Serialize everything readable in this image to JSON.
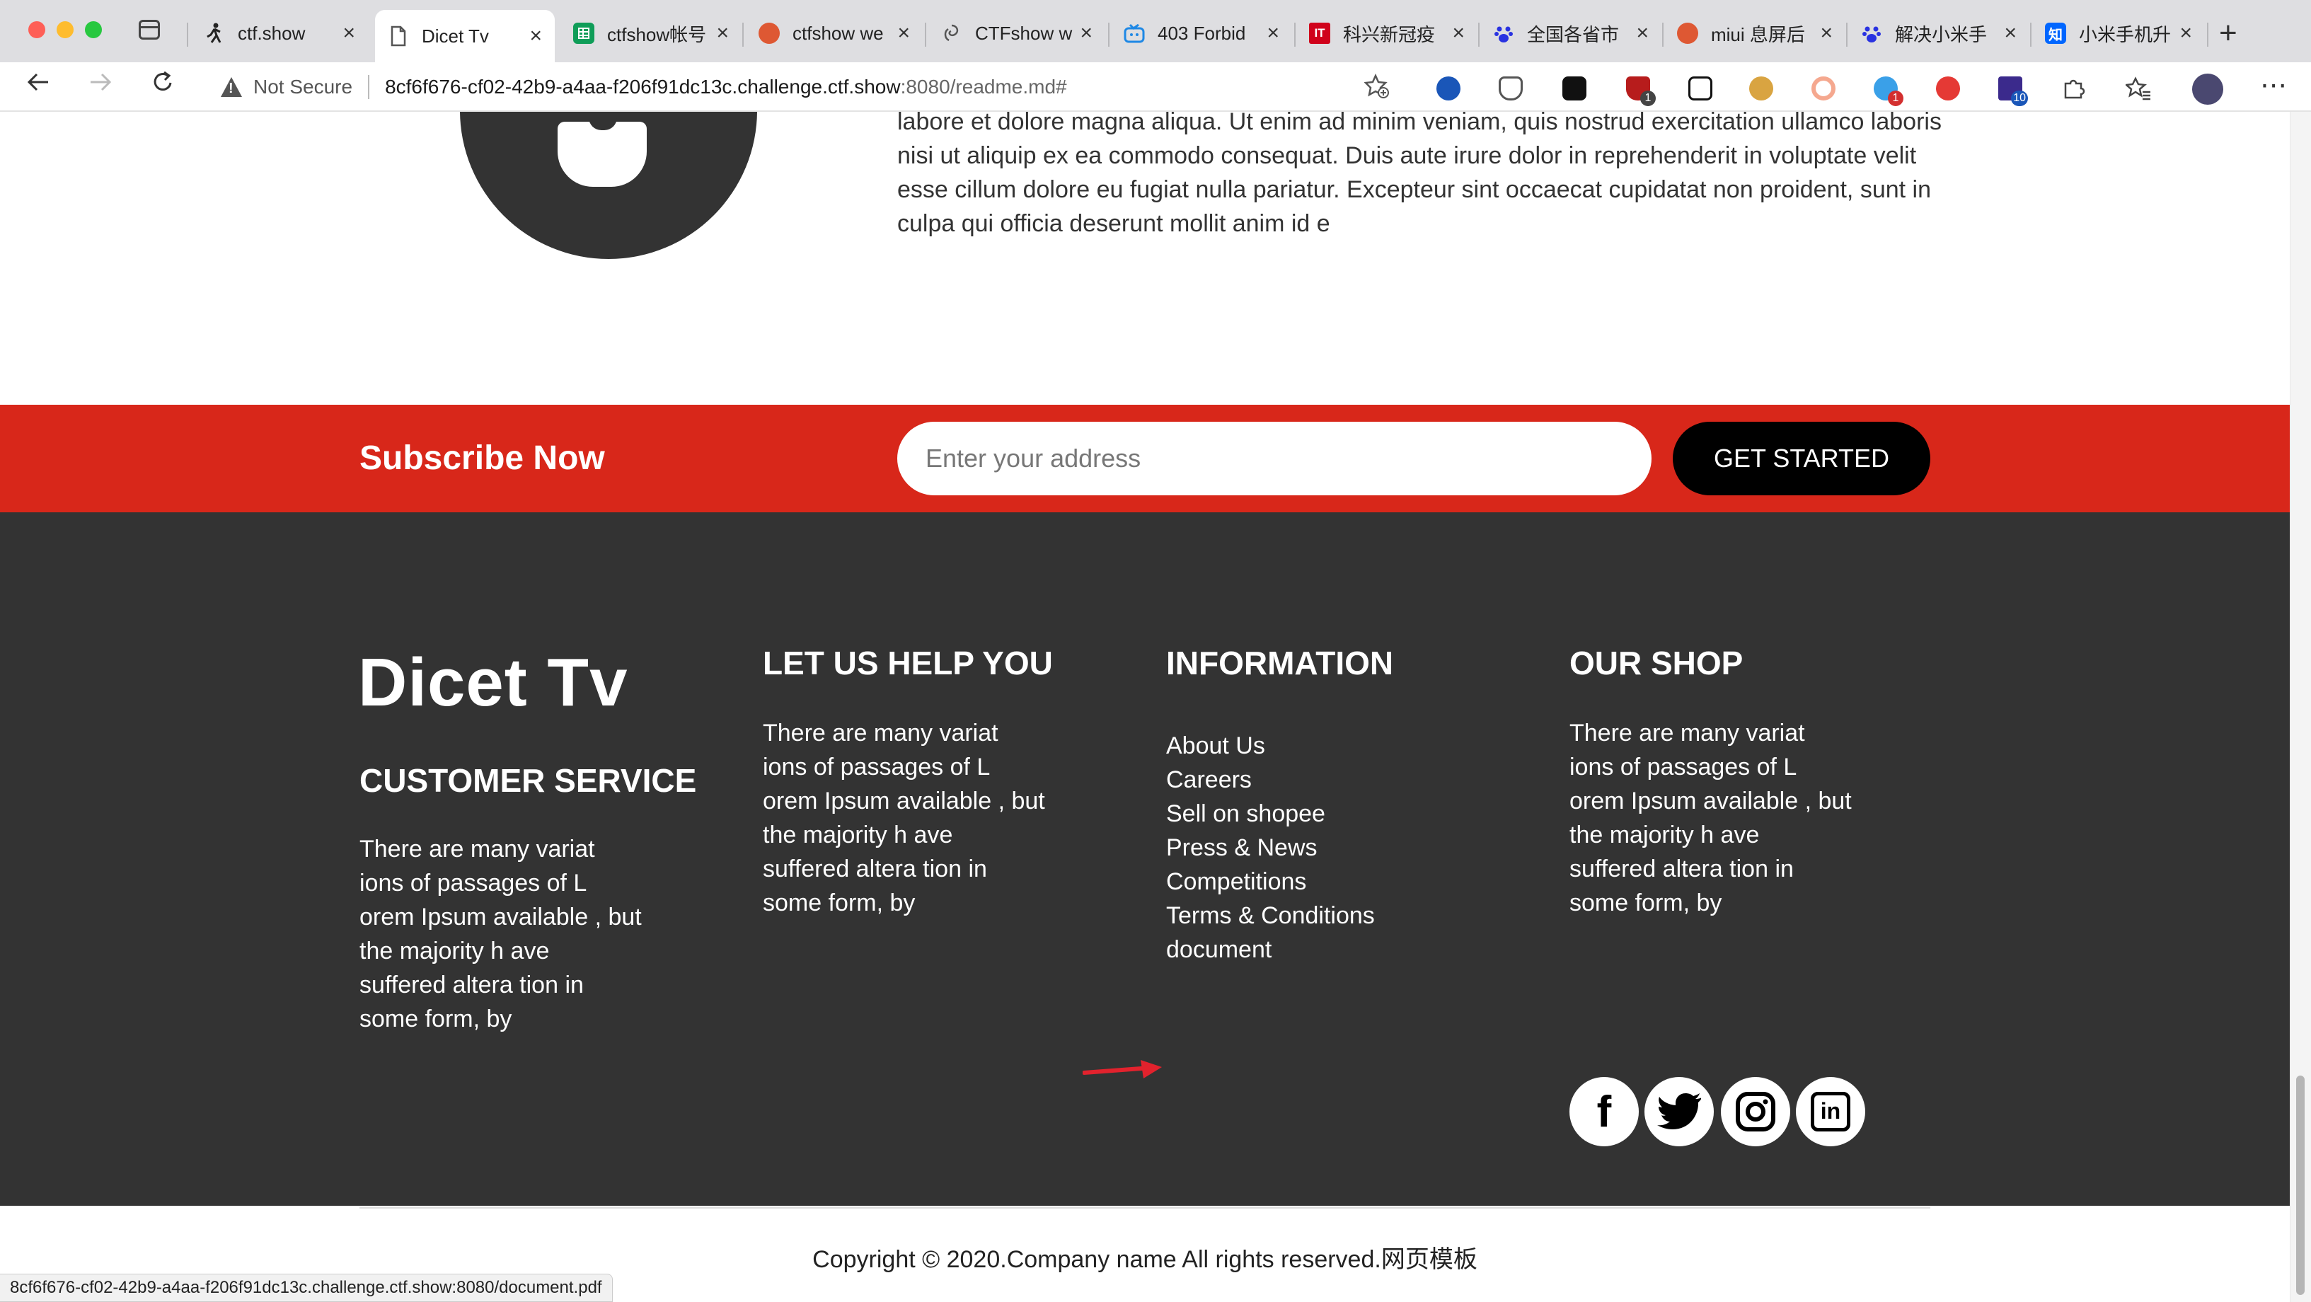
{
  "browser": {
    "tabs": [
      {
        "label": "ctf.show",
        "icon": "running-person-icon",
        "color": "#222222"
      },
      {
        "label": "Dicet Tv",
        "icon": "document-icon",
        "color": "#555555",
        "active": true
      },
      {
        "label": "ctfshow帐号",
        "icon": "sheet-icon",
        "color": "#0f9d58"
      },
      {
        "label": "ctfshow we",
        "icon": "duckduckgo-icon",
        "color": "#de5833"
      },
      {
        "label": "CTFshow w",
        "icon": "swirl-icon",
        "color": "#555555"
      },
      {
        "label": "403 Forbid",
        "icon": "tv-icon",
        "color": "#1e88e5"
      },
      {
        "label": "科兴新冠疫",
        "icon": "ithome-icon",
        "color": "#d0021b"
      },
      {
        "label": "全国各省市",
        "icon": "baidu-icon",
        "color": "#2932e1"
      },
      {
        "label": "miui 息屏后",
        "icon": "duckduckgo-icon",
        "color": "#de5833"
      },
      {
        "label": "解决小米手",
        "icon": "baidu-icon",
        "color": "#2932e1"
      },
      {
        "label": "小米手机升",
        "icon": "zhihu-icon",
        "color": "#0066ff"
      }
    ],
    "tab_icon_text": {
      "ithome": "IT",
      "zhihu": "知"
    },
    "close_glyph": "×",
    "new_tab_glyph": "+",
    "security_label": "Not Secure",
    "url_host": "8cf6f676-cf02-42b9-a4aa-f206f91dc13c.challenge.ctf.show",
    "url_rest": ":8080/readme.md#",
    "extension_badges": {
      "shield": "1",
      "globe": "1",
      "stack": "10"
    },
    "status_url": "8cf6f676-cf02-42b9-a4aa-f206f91dc13c.challenge.ctf.show:8080/document.pdf"
  },
  "about": {
    "text": "labore et dolore magna aliqua. Ut enim ad minim veniam, quis nostrud exercitation ullamco laboris nisi ut aliquip ex ea commodo consequat. Duis aute irure dolor in reprehenderit in voluptate velit esse cillum dolore eu fugiat nulla pariatur. Excepteur sint occaecat cupidatat non proident, sunt in culpa qui officia deserunt mollit anim id e"
  },
  "subscribe": {
    "title": "Subscribe Now",
    "placeholder": "Enter your address",
    "button": "GET STARTED",
    "band_color": "#d8271a"
  },
  "footer": {
    "brand": "Dicet Tv",
    "background": "#333333",
    "customer_service": {
      "title": "CUSTOMER SERVICE",
      "text": "There are many variat ions of passages of L orem Ipsum available , but the majority h ave suffered altera tion in some form, by"
    },
    "help": {
      "title": "LET US HELP YOU",
      "text": "There are many variat ions of passages of L orem Ipsum available , but the majority h ave suffered altera tion in some form, by"
    },
    "information": {
      "title": "INFORMATION",
      "links": [
        "About Us",
        "Careers",
        "Sell on shopee",
        "Press & News",
        "Competitions",
        "Terms & Conditions",
        "document"
      ]
    },
    "shop": {
      "title": "OUR SHOP",
      "text": "There are many variat ions of passages of L orem Ipsum available , but the majority h ave suffered altera tion in some form, by",
      "social": [
        "facebook-icon",
        "twitter-icon",
        "instagram-icon",
        "linkedin-icon"
      ],
      "social_glyphs": [
        "f",
        "in"
      ]
    },
    "copyright": "Copyright © 2020.Company name All rights reserved.网页模板"
  }
}
